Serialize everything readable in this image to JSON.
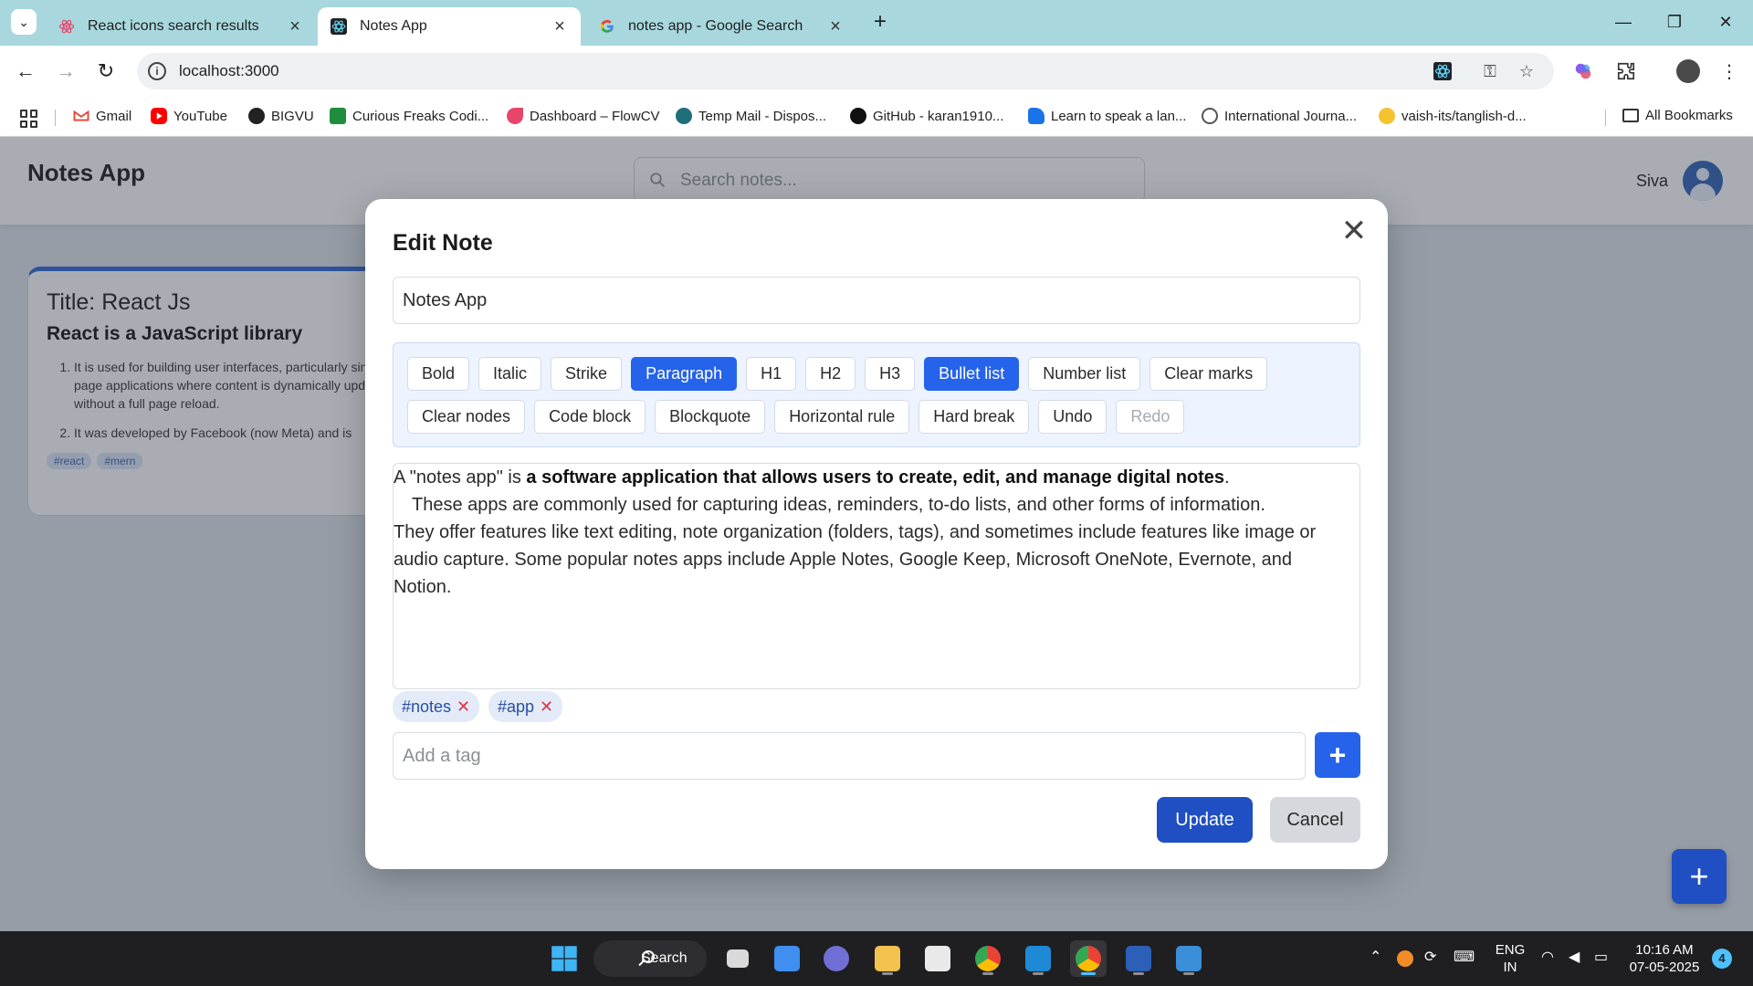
{
  "browser": {
    "tabs": [
      {
        "title": "React icons search results",
        "icon": "react-icon-pink",
        "active": false
      },
      {
        "title": "Notes App",
        "icon": "react-icon-dark",
        "active": true
      },
      {
        "title": "notes app - Google Search",
        "icon": "google-g-icon",
        "active": false
      }
    ],
    "url": "localhost:3000",
    "bookmarks": [
      {
        "label": "Gmail",
        "color": "#ea4335"
      },
      {
        "label": "YouTube",
        "color": "#ff0000"
      },
      {
        "label": "BIGVU",
        "color": "#222222"
      },
      {
        "label": "Curious Freaks Codi...",
        "color": "#1e8e3e"
      },
      {
        "label": "Dashboard – FlowCV",
        "color": "#e8456b"
      },
      {
        "label": "Temp Mail - Dispos...",
        "color": "#1f6f7a"
      },
      {
        "label": "GitHub - karan1910...",
        "color": "#111111"
      },
      {
        "label": "Learn to speak a lan...",
        "color": "#1a73e8"
      },
      {
        "label": "International Journa...",
        "color": "#555555"
      },
      {
        "label": "vaish-its/tanglish-d...",
        "color": "#f4c430"
      }
    ],
    "all_bookmarks": "All Bookmarks"
  },
  "app": {
    "title": "Notes App",
    "search_placeholder": "Search notes...",
    "user_name": "Siva",
    "note_card": {
      "title": "Title: React Js",
      "heading": "React is a JavaScript library",
      "items": [
        "It is used for building user interfaces, particularly single-page applications where content is dynamically updated without a full page reload.",
        "It was developed by Facebook (now Meta) and is"
      ],
      "tags": [
        "#react",
        "#mern"
      ]
    },
    "fab_label": "+"
  },
  "modal": {
    "title": "Edit Note",
    "close_label": "✕",
    "note_title_value": "Notes App",
    "toolbar_buttons": [
      {
        "label": "Bold",
        "state": "normal"
      },
      {
        "label": "Italic",
        "state": "normal"
      },
      {
        "label": "Strike",
        "state": "normal"
      },
      {
        "label": "Paragraph",
        "state": "active"
      },
      {
        "label": "H1",
        "state": "normal"
      },
      {
        "label": "H2",
        "state": "normal"
      },
      {
        "label": "H3",
        "state": "normal"
      },
      {
        "label": "Bullet list",
        "state": "active"
      },
      {
        "label": "Number list",
        "state": "normal"
      },
      {
        "label": "Clear marks",
        "state": "normal"
      },
      {
        "label": "Clear nodes",
        "state": "normal"
      },
      {
        "label": "Code block",
        "state": "normal"
      },
      {
        "label": "Blockquote",
        "state": "normal"
      },
      {
        "label": "Horizontal rule",
        "state": "normal"
      },
      {
        "label": "Hard break",
        "state": "normal"
      },
      {
        "label": "Undo",
        "state": "normal"
      },
      {
        "label": "Redo",
        "state": "disabled"
      }
    ],
    "content": {
      "line1_prefix": "A \"notes app\" is ",
      "line1_bold": "a software application that allows users to create, edit, and manage digital notes",
      "line1_suffix": ".",
      "line2": "These apps are commonly used for capturing ideas, reminders, to-do lists, and other forms of information.",
      "line3": "They offer features like text editing, note organization (folders, tags), and sometimes include features like image or audio capture. Some popular notes apps include Apple Notes, Google Keep, Microsoft OneNote, Evernote, and Notion."
    },
    "tags": [
      "#notes",
      "#app"
    ],
    "tag_remove_label": "✕",
    "tag_input_placeholder": "Add a tag",
    "add_tag_label": "+",
    "update_label": "Update",
    "cancel_label": "Cancel"
  },
  "taskbar": {
    "search_label": "Search",
    "lang_line1": "ENG",
    "lang_line2": "IN",
    "time": "10:16 AM",
    "date": "07-05-2025",
    "notification_count": "4"
  }
}
